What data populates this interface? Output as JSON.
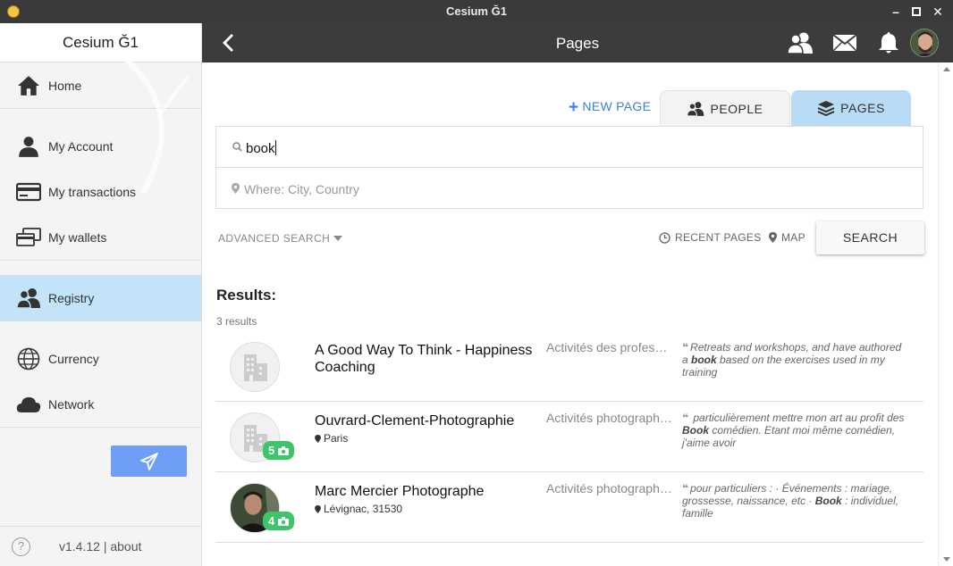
{
  "window": {
    "title": "Cesium Ğ1"
  },
  "sidebar": {
    "header": "Cesium Ğ1",
    "items": [
      {
        "label": "Home",
        "icon": "home-icon"
      },
      {
        "label": "My Account",
        "icon": "person-icon"
      },
      {
        "label": "My transactions",
        "icon": "credit-card-icon"
      },
      {
        "label": "My wallets",
        "icon": "wallets-icon"
      },
      {
        "label": "Registry",
        "icon": "people-icon",
        "active": true
      },
      {
        "label": "Currency",
        "icon": "globe-icon"
      },
      {
        "label": "Network",
        "icon": "cloud-icon"
      }
    ],
    "footer_version": "v1.4.12 | about"
  },
  "topbar": {
    "title": "Pages"
  },
  "tabs": {
    "new_page": "NEW PAGE",
    "people": "PEOPLE",
    "pages": "PAGES"
  },
  "search": {
    "value": "book",
    "where_placeholder": "Where: City, Country",
    "advanced": "ADVANCED SEARCH",
    "recent": "RECENT PAGES",
    "map": "MAP",
    "button": "SEARCH"
  },
  "results": {
    "title": "Results:",
    "count": "3 results",
    "items": [
      {
        "name": "A Good Way To Think - Happiness Coaching",
        "location": "",
        "category": "Activités des professions",
        "desc_before": "Retreats and workshops, and have authored a ",
        "desc_bold": "book",
        "desc_after": " based on the exercises used in my training",
        "photos": ""
      },
      {
        "name": "Ouvrard-Clement-Photographie",
        "location": "Paris",
        "category": "Activités photographiques",
        "desc_before": " particulièrement mettre mon art au profit des ",
        "desc_bold": "Book",
        "desc_after": " comédien. Etant moi même comédien, j'aime avoir",
        "photos": "5"
      },
      {
        "name": "Marc Mercier Photographe",
        "location": "Lévignac, 31530",
        "category": "Activités photographiques",
        "desc_before": "pour particuliers : · Événements : mariage, grossesse, naissance, etc · ",
        "desc_bold": "Book",
        "desc_after": " : individuel, famille",
        "photos": "4"
      }
    ]
  },
  "colors": {
    "accent": "#3d7fe0",
    "active_tab": "#b9dcf6",
    "registry_active": "#c2e3f8",
    "badge": "#3ec56a",
    "send_button": "#6f9ef6"
  }
}
